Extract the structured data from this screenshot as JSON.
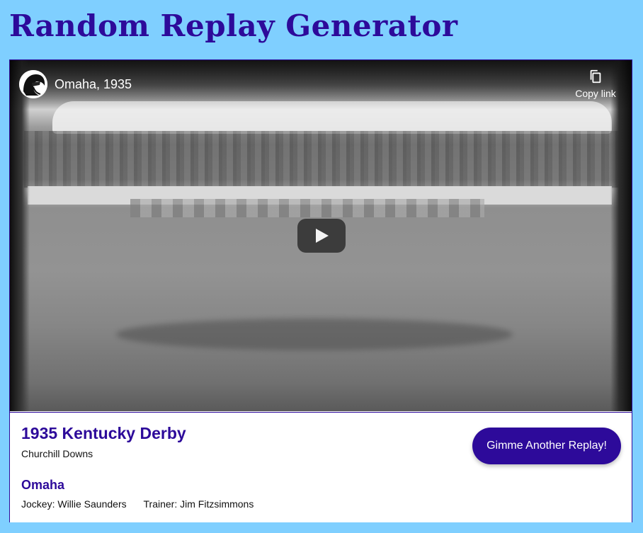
{
  "page": {
    "title": "Random Replay Generator"
  },
  "video": {
    "title": "Omaha, 1935",
    "copy_link_label": "Copy link",
    "channel_icon": "channel-avatar-icon",
    "play_icon": "play-icon",
    "copy_icon": "copy-icon"
  },
  "race": {
    "title": "1935 Kentucky Derby",
    "track": "Churchill Downs",
    "horse": "Omaha",
    "jockey": "Jockey: Willie Saunders",
    "trainer": "Trainer: Jim Fitzsimmons"
  },
  "actions": {
    "replay_label": "Gimme Another Replay!"
  },
  "colors": {
    "background": "#7fcfff",
    "accent": "#2d0a9a",
    "card": "#ffffff"
  }
}
